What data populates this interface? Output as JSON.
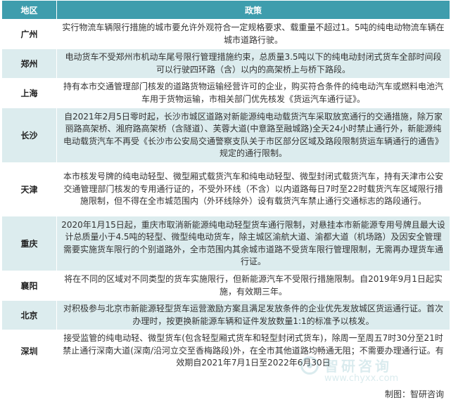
{
  "header": {
    "region": "地区",
    "policy": "政策"
  },
  "rows": [
    {
      "region": "广州",
      "policy": "实行物流车辆限行措施的城市要允许外观符合一定规格要求、载重量不超过1。5吨的纯电动物流车辆在城市道路行驶。"
    },
    {
      "region": "郑州",
      "policy": "电动货车不受郑州市机动车尾号限行管理措施约束，总质量3.5吨以下的纯电动封闭式货车全部时间段可以行驶四环路（含）以内的高架桥上与桥下路段。"
    },
    {
      "region": "上海",
      "policy": "持有本市交通管理部门核发的道路货物运输经营许可的企业，购买符合条件的纯电动汽车或燃料电池汽车用于货物运输，市相关部门优先核发《货运汽车通行证》。"
    },
    {
      "region": "长沙",
      "policy": "自2021年2月5日零时起，长沙市城区道路对新能源纯电动载货汽车采取放宽通行的交通措施，除万家丽路高架桥、湘府路高架桥（含隧道）、芙蓉大道(中意路至融城路)全天24小时禁止通行外，新能源纯电动载货汽车不再受《长沙市公安局交通警察支队关于市区部分区域及路段限制货运车辆通行的通告》规定的通行限制。"
    },
    {
      "region": "天津",
      "policy": "本市核发号牌的纯电动轻型、微型厢式载货汽车和纯电动轻型、微型封闭式载货汽车，持有天津市公安交通管理部门核发的专用通行证的，不受外环线（不含）以内道路每日7时至22时载货汽车区域限行措施限制，但不得在全市城范围内（外环线除外）设有载货汽车禁止通行交通标志的路段通行。"
    },
    {
      "region": "重庆",
      "policy": "2020年1月15日起，重庆市取消新能源纯电动轻型货车通行限制，对悬挂本市新能源专用号牌且最大设计总质量小于4.5吨的轻型、微型纯电动货车，除主城区渝航大道、渝都大道（机场路）及因安全管理需要实施货车限行的个别道路外，全市范围内其余城市道路不受货车限行管理限制，无需再办理货车通行证。"
    },
    {
      "region": "襄阳",
      "policy": "将在不同的区域对不同类型的货车实施限行，但新能源汽车不受限行措施限制。自2019年9月1日起实施，有效期三年。"
    },
    {
      "region": "北京",
      "policy": "对积极参与北京市新能源轻型货车运营激励方案且满足发放条件的企业优先发放城区货运通行证。首次办理时，按更换新能源车辆和证件发放数量1:1的标准予以核发。"
    },
    {
      "region": "深圳",
      "policy": "接受监管的纯电动轻、微型货车(包含轻型厢式货车和轻型封闭式货车)，除周一至周五7时30分至21时禁止通行深南大道(深南/沿河立交至香梅路段)外，在全市其他道路均畅通无阻；不需要办理通行证。有效期自2021年7月1日至2022年6月30日"
    }
  ],
  "source": "制图：智研咨询",
  "watermark": {
    "name": "智研咨询",
    "site": "www.chyxx.com"
  },
  "colors": {
    "header_bg": "#3e9dad",
    "stripe_bg": "#dcecee"
  }
}
